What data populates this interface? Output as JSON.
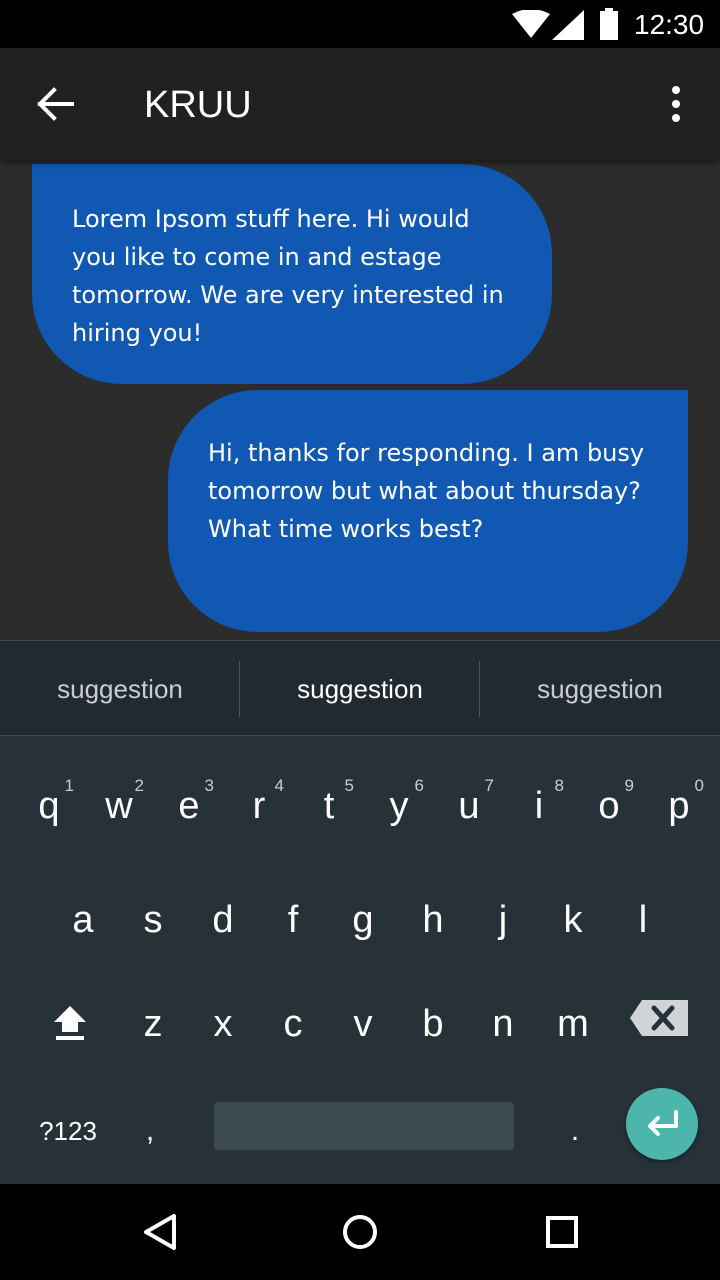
{
  "status_bar": {
    "time": "12:30",
    "icons": [
      "wifi-icon",
      "signal-icon",
      "battery-icon"
    ]
  },
  "app_bar": {
    "title": "KRUU",
    "back_icon": "arrow-back-icon",
    "menu_icon": "more-vert-icon"
  },
  "messages": [
    {
      "direction": "incoming",
      "text": "Lorem Ipsom stuff here. Hi would you like to come in and estage tomorrow. We are very interested in hiring you!"
    },
    {
      "direction": "outgoing",
      "text": "Hi, thanks for responding. I am busy tomorrow but what about thursday? What time works best?"
    }
  ],
  "suggestions": [
    "suggestion",
    "suggestion",
    "suggestion"
  ],
  "keyboard": {
    "row1": [
      {
        "key": "q",
        "num": "1"
      },
      {
        "key": "w",
        "num": "2"
      },
      {
        "key": "e",
        "num": "3"
      },
      {
        "key": "r",
        "num": "4"
      },
      {
        "key": "t",
        "num": "5"
      },
      {
        "key": "y",
        "num": "6"
      },
      {
        "key": "u",
        "num": "7"
      },
      {
        "key": "i",
        "num": "8"
      },
      {
        "key": "o",
        "num": "9"
      },
      {
        "key": "p",
        "num": "0"
      }
    ],
    "row2": [
      "a",
      "s",
      "d",
      "f",
      "g",
      "h",
      "j",
      "k",
      "l"
    ],
    "row3": [
      "z",
      "x",
      "c",
      "v",
      "b",
      "n",
      "m"
    ],
    "symbols_label": "?123",
    "comma_label": ",",
    "period_label": ".",
    "shift_icon": "shift-icon",
    "backspace_icon": "backspace-icon",
    "enter_icon": "enter-icon"
  },
  "colors": {
    "bubble": "#1158b3",
    "chat_background": "#2c2c2c",
    "app_bar": "#212121",
    "keyboard": "#263238",
    "enter_key": "#4db6ac"
  },
  "nav_bar": {
    "icons": [
      "back-triangle-icon",
      "home-circle-icon",
      "recents-square-icon"
    ]
  }
}
